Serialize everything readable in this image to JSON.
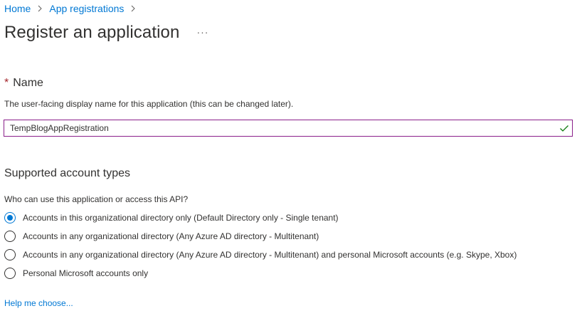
{
  "breadcrumb": {
    "items": [
      {
        "label": "Home"
      },
      {
        "label": "App registrations"
      }
    ]
  },
  "header": {
    "title": "Register an application",
    "more_label": "···"
  },
  "name_section": {
    "required_mark": "*",
    "heading": "Name",
    "description": "The user-facing display name for this application (this can be changed later).",
    "input_value": "TempBlogAppRegistration",
    "valid_icon": "checkmark-icon"
  },
  "account_types": {
    "heading": "Supported account types",
    "question": "Who can use this application or access this API?",
    "options": [
      {
        "label": "Accounts in this organizational directory only (Default Directory only - Single tenant)",
        "selected": true
      },
      {
        "label": "Accounts in any organizational directory (Any Azure AD directory - Multitenant)",
        "selected": false
      },
      {
        "label": "Accounts in any organizational directory (Any Azure AD directory - Multitenant) and personal Microsoft accounts (e.g. Skype, Xbox)",
        "selected": false
      },
      {
        "label": "Personal Microsoft accounts only",
        "selected": false
      }
    ],
    "help_link": "Help me choose..."
  },
  "colors": {
    "accent": "#0078d4",
    "input_border": "#8a1f8a",
    "valid_check": "#107c10",
    "required": "#a4262c"
  }
}
